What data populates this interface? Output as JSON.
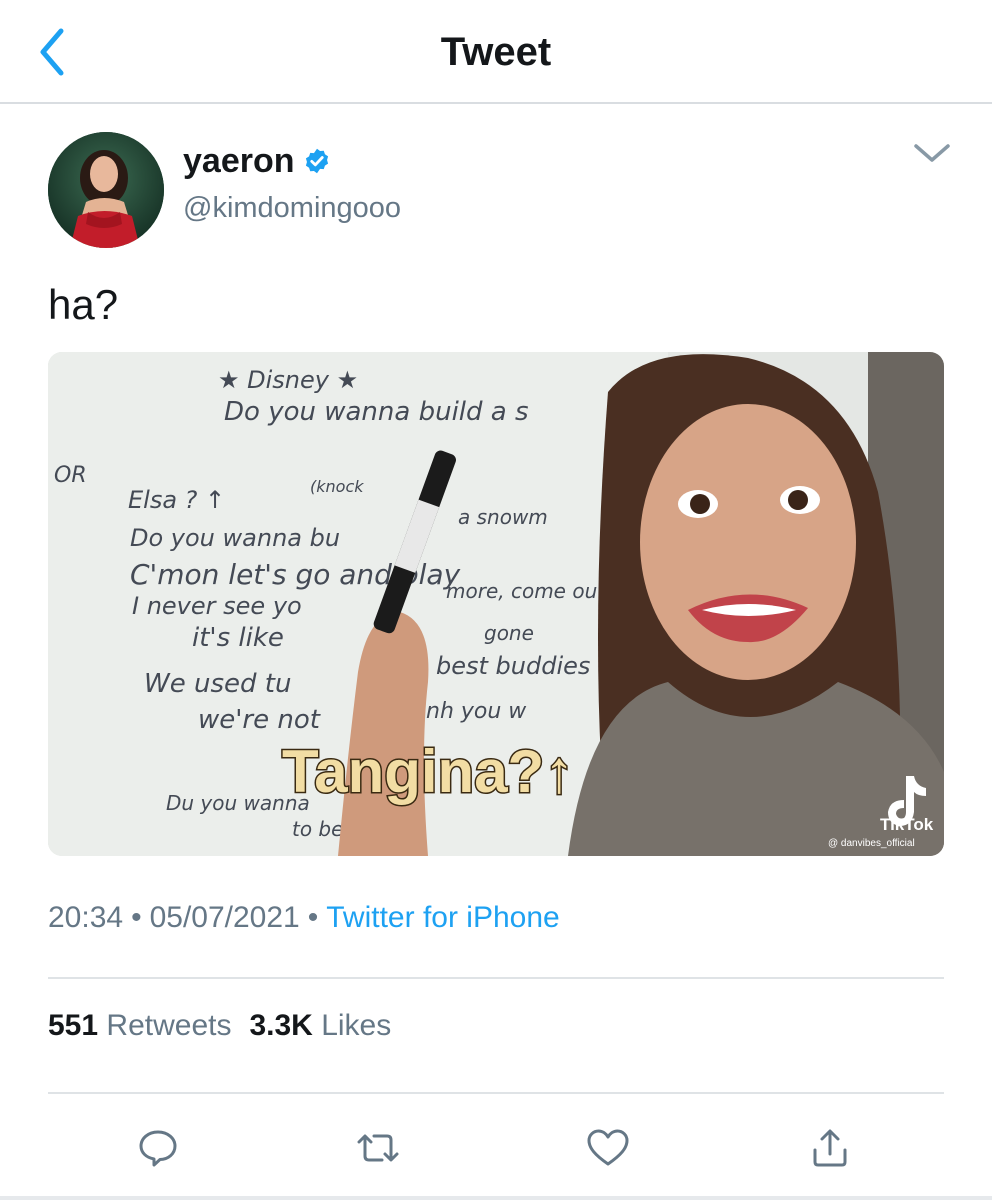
{
  "navbar": {
    "title": "Tweet",
    "back_icon": "chevron-left-icon"
  },
  "author": {
    "display_name": "yaeron",
    "handle": "@kimdomingooo",
    "verified": true
  },
  "tweet": {
    "text": "ha?",
    "media": {
      "whiteboard_lines": [
        "★ Disney ★",
        "Do you wanna build a s",
        "OR",
        "Elsa ? ↑",
        "(knock",
        "Do you wanna bu",
        "a snowm",
        "C'mon let's go and play",
        "I never see yo",
        "more, come ou",
        "it's like",
        "gone",
        "We used tu",
        "best buddies",
        "we're not",
        "nh you w",
        "Du you wanna",
        "to be"
      ],
      "caption": "Tangina?↑",
      "watermark_brand": "TikTok",
      "watermark_handle": "@ danvibes_official"
    }
  },
  "meta": {
    "time": "20:34",
    "date": "05/07/2021",
    "separator": "•",
    "source": "Twitter for iPhone"
  },
  "stats": {
    "retweets_count": "551",
    "retweets_label": "Retweets",
    "likes_count": "3.3K",
    "likes_label": "Likes"
  },
  "actions": [
    "reply-icon",
    "retweet-icon",
    "like-icon",
    "share-icon"
  ],
  "colors": {
    "accent": "#1da1f2",
    "secondary_text": "#657786",
    "primary_text": "#14171a",
    "divider": "#dfe3e6"
  }
}
